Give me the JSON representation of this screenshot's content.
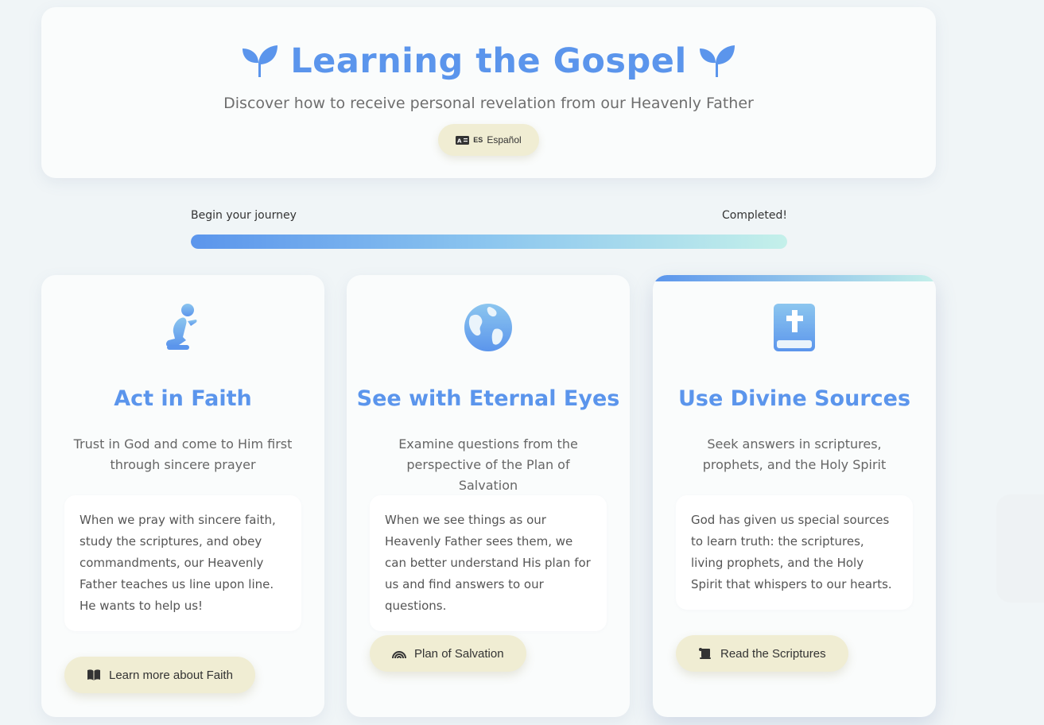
{
  "header": {
    "title": "Learning the Gospel",
    "title_icon": "seedling-icon",
    "subtitle": "Discover how to receive personal revelation from our Heavenly Father",
    "language_button": {
      "icon": "language-icon",
      "code": "ES",
      "label": "Español"
    }
  },
  "progress": {
    "start_label": "Begin your journey",
    "end_label": "Completed!",
    "value_percent": 100
  },
  "cards": [
    {
      "icon": "praying-person-icon",
      "title": "Act in Faith",
      "description": "Trust in God and come to Him first through sincere prayer",
      "detail": "When we pray with sincere faith, study the scriptures, and obey commandments, our Heavenly Father teaches us line upon line. He wants to help us!",
      "button": {
        "icon": "book-open-icon",
        "label": "Learn more about Faith"
      }
    },
    {
      "icon": "globe-icon",
      "title": "See with Eternal Eyes",
      "description": "Examine questions from the perspective of the Plan of Salvation",
      "detail": "When we see things as our Heavenly Father sees them, we can better understand His plan for us and find answers to our questions.",
      "button": {
        "icon": "rainbow-icon",
        "label": "Plan of Salvation"
      }
    },
    {
      "icon": "bible-icon",
      "title": "Use Divine Sources",
      "description": "Seek answers in scriptures, prophets, and the Holy Spirit",
      "detail": "God has given us special sources to learn truth: the scriptures, living prophets, and the Holy Spirit that whispers to our hearts.",
      "button": {
        "icon": "scroll-icon",
        "label": "Read the Scriptures"
      }
    }
  ],
  "colors": {
    "accent": "#5b95ec",
    "gradient_end": "#c4f0ea",
    "button_bg": "#f0edd3",
    "page_bg": "#f0f5f7"
  }
}
